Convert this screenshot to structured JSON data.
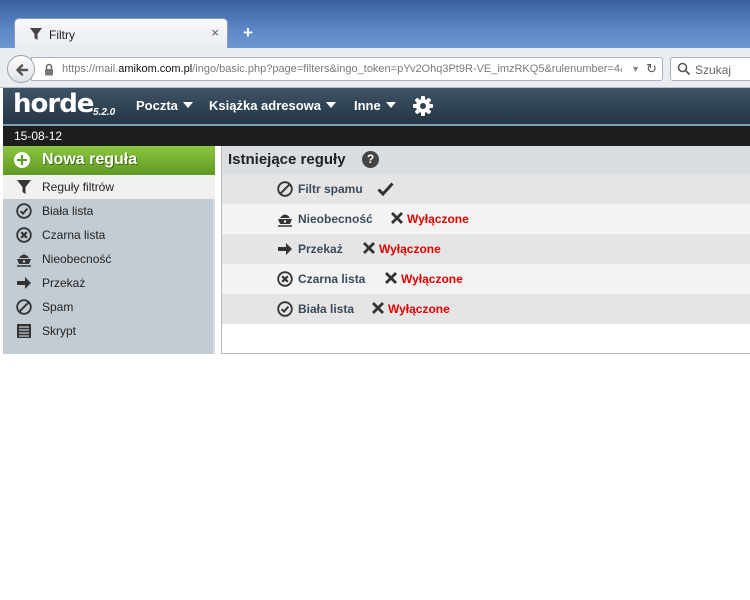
{
  "browser": {
    "tab_title": "Filtry",
    "tab_close": "×",
    "new_tab": "+",
    "url_prefix": "https://mail.",
    "url_host": "amikom.com.pl",
    "url_rest": "/ingo/basic.php?page=filters&ingo_token=pYv2Ohq3Pt9R-VE_imzRKQ5&rulenumber=4&a",
    "search_placeholder": "Szukaj"
  },
  "horde": {
    "logo": "horde",
    "version": "5.2.0",
    "menus": [
      "Poczta",
      "Książka adresowa",
      "Inne"
    ],
    "date": "15-08-12"
  },
  "sidebar": {
    "new_rule": "Nowa reguła",
    "items": [
      {
        "label": "Reguły filtrów",
        "icon": "filter-icon",
        "active": true
      },
      {
        "label": "Biała lista",
        "icon": "check-circle-icon",
        "active": false
      },
      {
        "label": "Czarna lista",
        "icon": "x-circle-icon",
        "active": false
      },
      {
        "label": "Nieobecność",
        "icon": "vacation-icon",
        "active": false
      },
      {
        "label": "Przekaż",
        "icon": "arrow-right-icon",
        "active": false
      },
      {
        "label": "Spam",
        "icon": "no-entry-icon",
        "active": false
      },
      {
        "label": "Skrypt",
        "icon": "script-icon",
        "active": false
      }
    ]
  },
  "main": {
    "title": "Istniejące reguły",
    "help": "?",
    "rules": [
      {
        "name": "Filtr spamu",
        "icon": "no-entry-icon",
        "status": "enabled",
        "status_label": ""
      },
      {
        "name": "Nieobecność",
        "icon": "vacation-icon",
        "status": "disabled",
        "status_label": "Wyłączone"
      },
      {
        "name": "Przekaż",
        "icon": "arrow-right-icon",
        "status": "disabled",
        "status_label": "Wyłączone"
      },
      {
        "name": "Czarna lista",
        "icon": "x-circle-icon",
        "status": "disabled",
        "status_label": "Wyłączone"
      },
      {
        "name": "Biała lista",
        "icon": "check-circle-icon",
        "status": "disabled",
        "status_label": "Wyłączone"
      }
    ]
  },
  "colors": {
    "disabled_text": "#e00000",
    "new_rule_green": "#6eaa2c",
    "horde_bar": "#2f4354"
  }
}
